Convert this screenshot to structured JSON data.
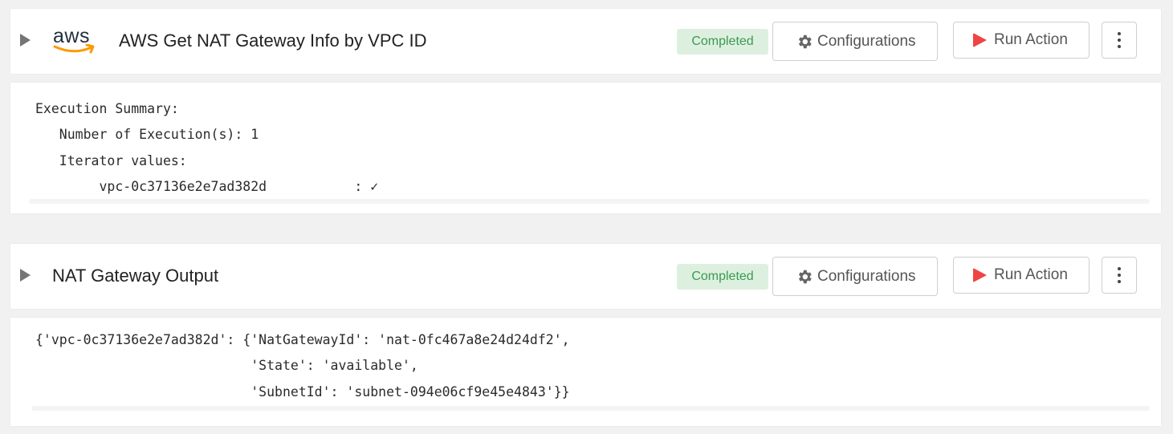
{
  "tasks": [
    {
      "logo_text": "aws",
      "title": "AWS Get NAT Gateway Info by VPC ID",
      "status": "Completed",
      "config_label": "Configurations",
      "run_label": "Run Action",
      "output": "Execution Summary:\n   Number of Execution(s): 1\n   Iterator values:\n        vpc-0c37136e2e7ad382d           : ✓"
    },
    {
      "title": "NAT Gateway Output",
      "status": "Completed",
      "config_label": "Configurations",
      "run_label": "Run Action",
      "output": "{'vpc-0c37136e2e7ad382d': {'NatGatewayId': 'nat-0fc467a8e24d24df2',\n                           'State': 'available',\n                           'SubnetId': 'subnet-094e06cf9e45e4843'}}"
    }
  ],
  "colors": {
    "status_bg": "#ddf0e0",
    "status_text": "#3a9a4f",
    "run_icon": "#ef4444",
    "aws_smile": "#ff9900"
  },
  "icons": {
    "expand": "triangle-right-icon",
    "config": "gear-icon",
    "run": "play-icon",
    "more": "kebab-menu-icon",
    "logo": "aws-logo"
  }
}
